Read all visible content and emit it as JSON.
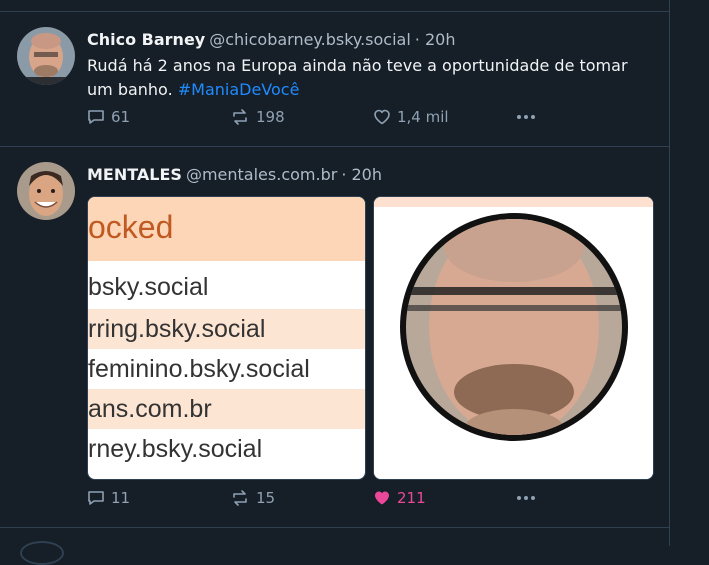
{
  "posts": [
    {
      "author_name": "Chico Barney",
      "author_handle": "@chicobarney.bsky.social",
      "time": "· 20h",
      "text_plain": "Rudá há 2 anos na Europa ainda não teve a oportunidade de tomar um banho. ",
      "hashtag": "#ManiaDeVocê",
      "replies": "61",
      "reposts": "198",
      "likes": "1,4 mil"
    },
    {
      "author_name": "MENTALES",
      "author_handle": "@mentales.com.br",
      "time": "· 20h",
      "replies": "11",
      "reposts": "15",
      "likes": "211",
      "image1": {
        "header": "ocked",
        "rows": [
          "bsky.social",
          "rring.bsky.social",
          "feminino.bsky.social",
          "ans.com.br",
          "rney.bsky.social"
        ]
      }
    }
  ],
  "colors": {
    "background": "#161e27",
    "link": "#208bfe",
    "like_active": "#ec4899",
    "muted": "#8fa1b3"
  },
  "icons": [
    "reply-icon",
    "repost-icon",
    "heart-icon",
    "more-icon"
  ]
}
